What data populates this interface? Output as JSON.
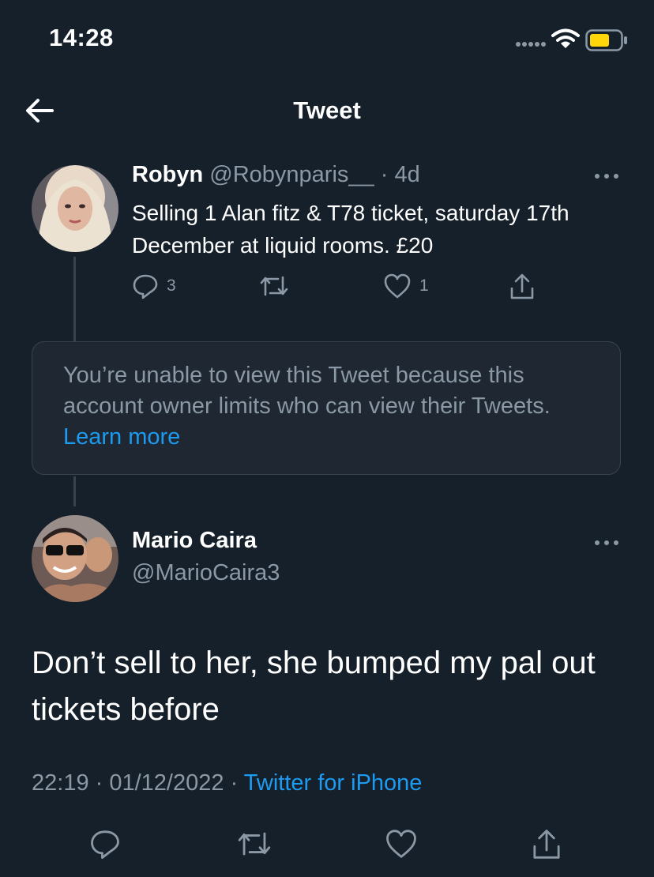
{
  "status_bar": {
    "time": "14:28"
  },
  "header": {
    "title": "Tweet"
  },
  "robyn_tweet": {
    "name": "Robyn",
    "handle": "@Robynparis__",
    "separator": " · ",
    "age": "4d",
    "text": "Selling 1 Alan fitz & T78 ticket, saturday 17th December at liquid rooms. £20",
    "reply_count": "3",
    "like_count": "1"
  },
  "restricted_notice": {
    "text": "You’re unable to view this Tweet because this account owner limits who can view their Tweets. ",
    "link": "Learn more"
  },
  "mario_tweet": {
    "name": "Mario Caira",
    "handle": "@MarioCaira3",
    "text": "Don’t sell to her, she bumped my pal out tickets before",
    "time": "22:19",
    "date": "01/12/2022",
    "separator": " · ",
    "source": "Twitter for iPhone"
  },
  "colors": {
    "background": "#15202b",
    "accent": "#1d9bf0",
    "muted": "#8b98a5",
    "border": "#38444d",
    "battery": "#ffd60a"
  },
  "icons": [
    "back-arrow-icon",
    "more-icon",
    "reply-icon",
    "retweet-icon",
    "like-icon",
    "share-icon",
    "signal-icon",
    "wifi-icon",
    "battery-icon"
  ]
}
